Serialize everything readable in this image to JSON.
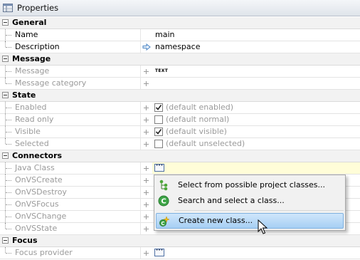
{
  "panel": {
    "title": "Properties"
  },
  "categories": {
    "general": {
      "label": "General",
      "name": {
        "label": "Name",
        "value": "main"
      },
      "description": {
        "label": "Description",
        "value": "namespace"
      }
    },
    "message": {
      "label": "Message",
      "message": {
        "label": "Message",
        "value": "TEXT"
      },
      "message_category": {
        "label": "Message category"
      }
    },
    "state": {
      "label": "State",
      "enabled": {
        "label": "Enabled",
        "checked": true,
        "value": "(default enabled)"
      },
      "read_only": {
        "label": "Read only",
        "checked": false,
        "value": "(default normal)"
      },
      "visible": {
        "label": "Visible",
        "checked": true,
        "value": "(default visible)"
      },
      "selected": {
        "label": "Selected",
        "checked": false,
        "value": "(default unselected)"
      }
    },
    "connectors": {
      "label": "Connectors",
      "java_class": {
        "label": "Java Class"
      },
      "on_vs_create": {
        "label": "OnVSCreate"
      },
      "on_vs_destroy": {
        "label": "OnVSDestroy"
      },
      "on_vs_focus": {
        "label": "OnVSFocus"
      },
      "on_vs_change": {
        "label": "OnVSChange"
      },
      "on_vs_state": {
        "label": "OnVSState"
      }
    },
    "focus": {
      "label": "Focus",
      "focus_provider": {
        "label": "Focus provider"
      }
    }
  },
  "popup_menu": {
    "items": [
      {
        "label": "Select from possible project classes...",
        "icon": "hierarchy-icon"
      },
      {
        "label": "Search and select a class...",
        "icon": "search-class-icon"
      },
      {
        "label": "Create new class...",
        "icon": "new-class-icon",
        "highlighted": true
      }
    ]
  },
  "colors": {
    "highlight": "#a6cff3",
    "disabled_text": "#9a9a9a",
    "category_bg": "#f2f2f2"
  }
}
